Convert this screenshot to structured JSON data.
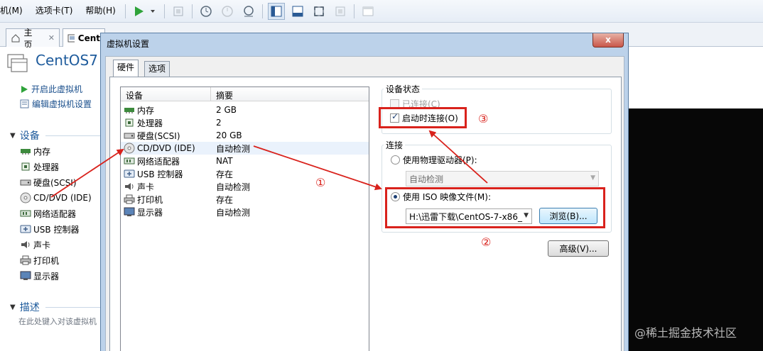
{
  "menubar": {
    "items": [
      "机(M)",
      "选项卡(T)",
      "帮助(H)"
    ]
  },
  "tabs": {
    "home": "主页",
    "vm": "Cent"
  },
  "left_panel": {
    "vm_name": "CentOS7",
    "actions": [
      "开启此虚拟机",
      "编辑虚拟机设置"
    ],
    "devices_heading": "设备",
    "devices": [
      "内存",
      "处理器",
      "硬盘(SCSI)",
      "CD/DVD (IDE)",
      "网络适配器",
      "USB 控制器",
      "声卡",
      "打印机",
      "显示器"
    ],
    "description_heading": "描述",
    "description_hint": "在此处键入对该虚拟机"
  },
  "dialog": {
    "title": "虚拟机设置",
    "close": "x",
    "tabs": [
      "硬件",
      "选项"
    ],
    "device_list": {
      "columns": [
        "设备",
        "摘要"
      ],
      "rows": [
        {
          "device": "内存",
          "summary": "2 GB"
        },
        {
          "device": "处理器",
          "summary": "2"
        },
        {
          "device": "硬盘(SCSI)",
          "summary": "20 GB"
        },
        {
          "device": "CD/DVD (IDE)",
          "summary": "自动检测"
        },
        {
          "device": "网络适配器",
          "summary": "NAT"
        },
        {
          "device": "USB 控制器",
          "summary": "存在"
        },
        {
          "device": "声卡",
          "summary": "自动检测"
        },
        {
          "device": "打印机",
          "summary": "存在"
        },
        {
          "device": "显示器",
          "summary": "自动检测"
        }
      ]
    },
    "device_status": {
      "label": "设备状态",
      "connected": "已连接(C)",
      "connect_at_power_on": "启动时连接(O)"
    },
    "connection": {
      "label": "连接",
      "physical_drive": "使用物理驱动器(P):",
      "physical_drive_value": "自动检测",
      "iso_image": "使用 ISO 映像文件(M):",
      "iso_path": "H:\\迅雷下载\\CentOS-7-x86_",
      "browse": "浏览(B)...",
      "advanced": "高级(V)..."
    }
  },
  "annotations": {
    "marker_1": "①",
    "marker_2": "②",
    "marker_3": "③"
  },
  "watermark": "@稀土掘金技术社区",
  "colors": {
    "annotation_red": "#d9221c",
    "title_blue": "#1e5b9c"
  }
}
